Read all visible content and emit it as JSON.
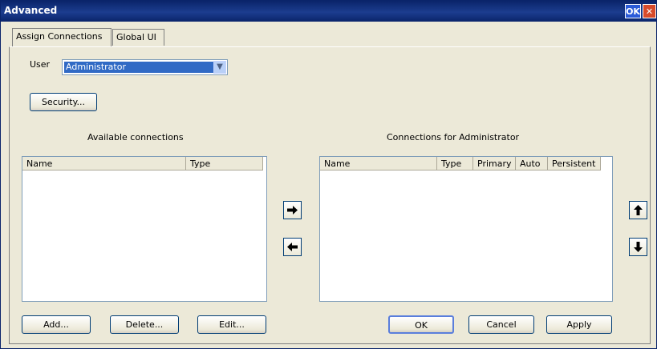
{
  "window": {
    "title": "Advanced",
    "ok_label": "OK",
    "close_label": "✕"
  },
  "tabs": [
    "Assign Connections",
    "Global UI"
  ],
  "user": {
    "label": "User",
    "selected": "Administrator"
  },
  "security_button": "Security...",
  "available": {
    "title": "Available connections",
    "columns": [
      "Name",
      "Type"
    ],
    "rows": []
  },
  "assigned": {
    "title": "Connections for Administrator",
    "columns": [
      "Name",
      "Type",
      "Primary",
      "Auto",
      "Persistent"
    ],
    "rows": []
  },
  "buttons": {
    "add": "Add...",
    "delete": "Delete...",
    "edit": "Edit...",
    "ok": "OK",
    "cancel": "Cancel",
    "apply": "Apply"
  },
  "icons": {
    "move_right": "arrow-right-icon",
    "move_left": "arrow-left-icon",
    "move_up": "arrow-up-icon",
    "move_down": "arrow-down-icon"
  }
}
